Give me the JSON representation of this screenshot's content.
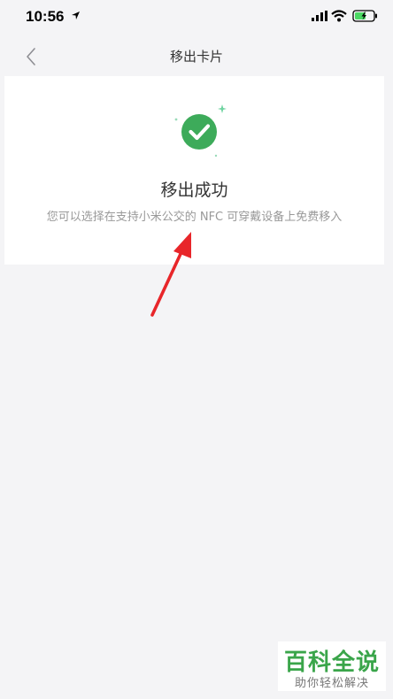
{
  "status_bar": {
    "time": "10:56",
    "icons": [
      "location-arrow-icon",
      "signal-icon",
      "wifi-icon",
      "battery-charging-icon"
    ]
  },
  "nav": {
    "title": "移出卡片",
    "back_icon": "chevron-left-icon"
  },
  "result": {
    "icon": "check-circle-icon",
    "accent_color": "#3dab5a",
    "title": "移出成功",
    "description": "您可以选择在支持小米公交的 NFC 可穿戴设备上免费移入"
  },
  "annotation": {
    "icon": "red-arrow-icon",
    "color": "#e8262a"
  },
  "watermark": {
    "title": "百科全说",
    "subtitle": "助你轻松解决"
  }
}
